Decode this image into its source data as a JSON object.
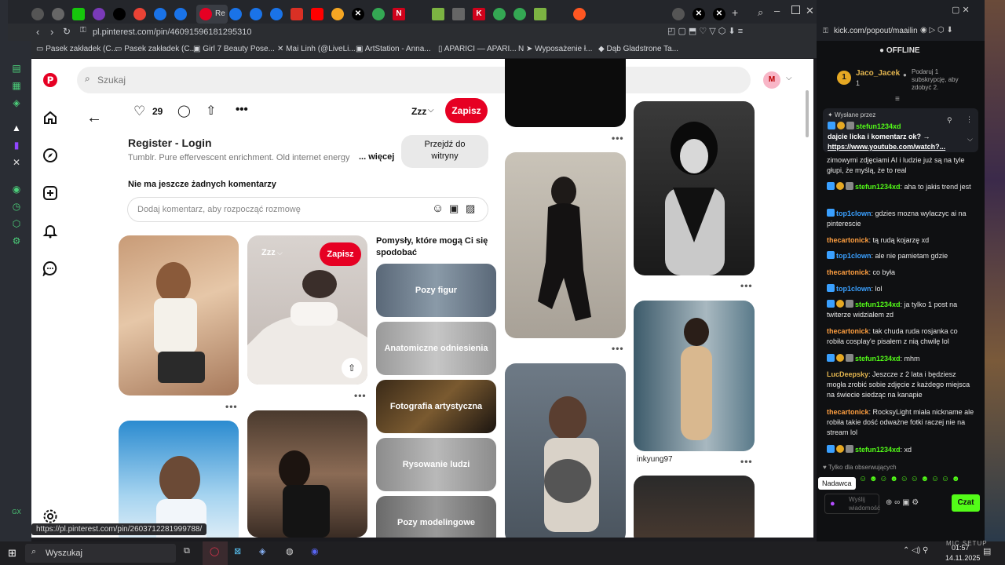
{
  "browser": {
    "url": "pl.pinterest.com/pin/46091596181295310",
    "bookmarks": [
      "Pasek zakładek (C...",
      "Pasek zakładek (C...",
      "Girl 7 Beauty Pose...",
      "Mai Linh (@LiveLi...",
      "ArtStation - Anna...",
      "APARICI — APARI...",
      "➤ Wyposażenie ł...",
      "Dąb Gladstrone Ta..."
    ],
    "active_tab_label": "Re",
    "status_url": "https://pl.pinterest.com/pin/2603712281999788/"
  },
  "pinterest": {
    "search_placeholder": "Szukaj",
    "avatar_letter": "M",
    "like_count": "29",
    "board_name": "Zzz",
    "save_label": "Zapisz",
    "pin_title": "Register - Login",
    "pin_description": "Tumblr. Pure effervescent enrichment. Old internet energy",
    "more_label": "... więcej",
    "visit_site_label": "Przejdź do witryny",
    "no_comments": "Nie ma jeszcze żadnych komentarzy",
    "comment_placeholder": "Dodaj komentarz, aby rozpocząć rozmowę",
    "ideas_heading": "Pomysły, które mogą Ci się spodobać",
    "ideas": [
      "Pozy figur",
      "Anatomiczne odniesienia",
      "Fotografia artystyczna",
      "Rysowanie ludzi",
      "Pozy modelingowe"
    ],
    "card_board": "Zzz",
    "card_save": "Zapisz",
    "pin_author": "inkyung97"
  },
  "kick": {
    "url": "kick.com/popout/maailin",
    "status": "OFFLINE",
    "top_user": "Jaco_Jacek",
    "top_rank": "1",
    "top_count": "1",
    "sub_prompt": "Podaruj 1 subskrypcję, aby zdobyć 2.",
    "pinned_label": "Wysłane przez",
    "pinned_user": "stefun1234xd",
    "pinned_text": "dajcie licka i komentarz ok? →",
    "pinned_link": "https://www.youtube.com/watch?...",
    "messages": [
      {
        "user": "",
        "text": "zimowymi zdjęciami AI i ludzie już są na tyle głupi, że myślą, że to real"
      },
      {
        "user": "stefun1234xd",
        "text": "aha to jakis trend jest"
      },
      {
        "user": "top1clown",
        "text": "gdzies mozna wylaczyc ai na pinterescie"
      },
      {
        "user": "thecartonick",
        "text": "tą rudą kojarzę xd"
      },
      {
        "user": "top1clown",
        "text": "ale nie pamietam gdzie"
      },
      {
        "user": "thecartonick",
        "text": "co była"
      },
      {
        "user": "top1clown",
        "text": "lol"
      },
      {
        "user": "stefun1234xd",
        "text": "ja tylko 1 post na twiterze widzialem zd"
      },
      {
        "user": "thecartonick",
        "text": "tak chuda ruda rosjanka co robiła cosplay'e pisałem z nią chwilę lol"
      },
      {
        "user": "stefun1234xd",
        "text": "mhm"
      },
      {
        "user": "LucDeepsky",
        "text": "Jeszcze z 2 lata i będziesz mogła zrobić sobie zdjęcie z każdego miejsca na świecie siedząc na kanapie"
      },
      {
        "user": "thecartonick",
        "text": "RocksyLight miała nickname ale robiła takie dość odważne fotki raczej nie na stream lol"
      },
      {
        "user": "stefun1234xd",
        "text": "xd"
      }
    ],
    "followers_only": "Tylko dla obserwujących",
    "tooltip": "Nadawca",
    "input_placeholder": "Wyślij wiadomość",
    "chat_button": "Czat"
  },
  "taskbar": {
    "search": "Wyszukaj",
    "time": "01:57",
    "date": "14.11.2025",
    "desktop_text": "MIC SETUP"
  }
}
